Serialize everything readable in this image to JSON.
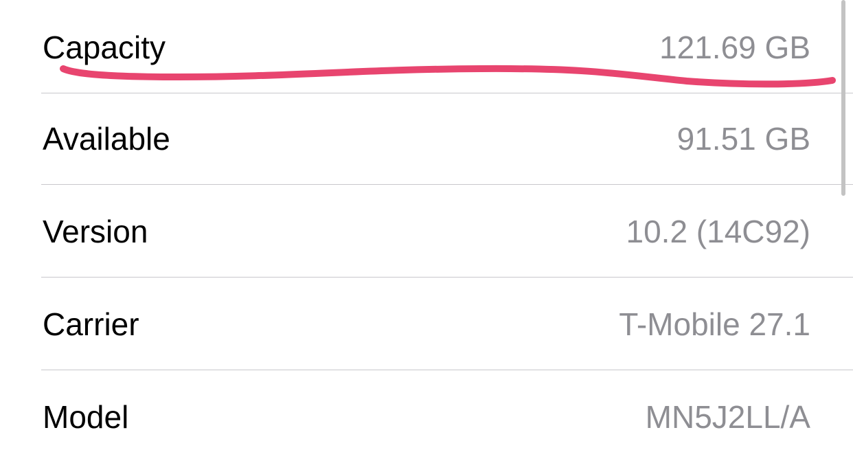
{
  "about": {
    "rows": [
      {
        "label": "Capacity",
        "value": "121.69 GB"
      },
      {
        "label": "Available",
        "value": "91.51 GB"
      },
      {
        "label": "Version",
        "value": "10.2 (14C92)"
      },
      {
        "label": "Carrier",
        "value": "T-Mobile 27.1"
      },
      {
        "label": "Model",
        "value": "MN5J2LL/A"
      }
    ]
  },
  "annotation": {
    "color": "#e8456f",
    "target": "Capacity"
  },
  "colors": {
    "label": "#000000",
    "value": "#8e8e93",
    "divider": "#c8c7cc"
  }
}
